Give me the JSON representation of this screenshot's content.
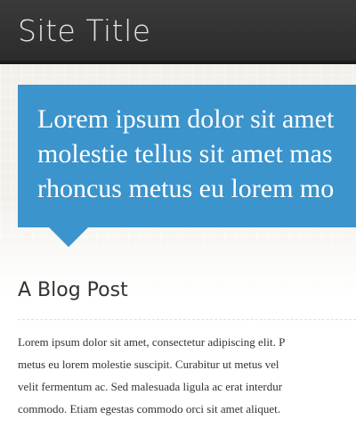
{
  "header": {
    "site_title": "Site Title",
    "bg_color": "#2f2f2f"
  },
  "hero": {
    "lines": [
      "Lorem ipsum dolor sit amet",
      "molestie tellus sit amet mas",
      "rhoncus metus eu lorem mo"
    ],
    "bg_color": "#3b94cc"
  },
  "post": {
    "title": "A Blog Post",
    "body_lines": [
      "Lorem ipsum dolor sit amet, consectetur adipiscing elit. P",
      "metus eu lorem molestie suscipit. Curabitur ut metus vel",
      "velit fermentum ac. Sed malesuada ligula ac erat interdur",
      "commodo. Etiam egestas commodo orci sit amet aliquet."
    ]
  }
}
